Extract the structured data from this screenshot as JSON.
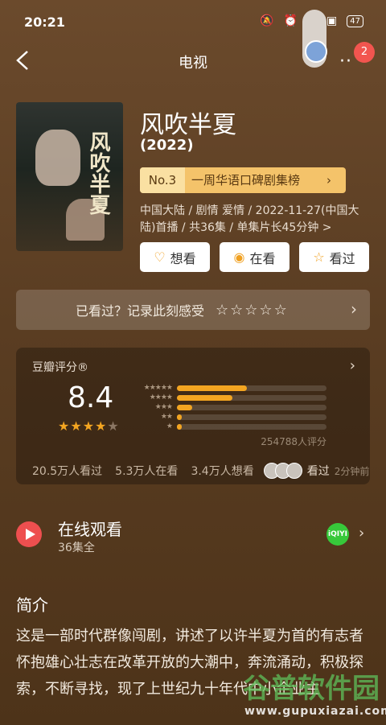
{
  "status": {
    "time": "20:21",
    "battery": "47"
  },
  "nav": {
    "title": "电视",
    "badge": "2",
    "more": "··"
  },
  "poster": {
    "title": "风吹半夏"
  },
  "show": {
    "title": "风吹半夏",
    "year": "(2022)",
    "rank_no": "No.3",
    "rank_name": "一周华语口碑剧集榜",
    "meta": "中国大陆 / 剧情 爱情 / 2022-11-27(中国大陆)首播 / 共36集 / 单集片长45分钟 >"
  },
  "actions": {
    "want": "想看",
    "watching": "在看",
    "watched": "看过"
  },
  "record": {
    "text": "已看过？记录此刻感受",
    "stars": "☆☆☆☆☆"
  },
  "rating": {
    "label": "豆瓣评分®",
    "score": "8.4",
    "stars_full": "★★★★",
    "stars_empty": "★",
    "distribution": [
      {
        "label": "★★★★★",
        "fraction": 0.47
      },
      {
        "label": "★★★★",
        "fraction": 0.37
      },
      {
        "label": "★★★",
        "fraction": 0.1
      },
      {
        "label": "★★",
        "fraction": 0.03
      },
      {
        "label": "★",
        "fraction": 0.03
      }
    ],
    "count": "254788人评分",
    "watched": "20.5万人看过",
    "watching": "5.3万人在看",
    "want": "3.4万人想看",
    "seen": "看过",
    "ago": "2分钟前"
  },
  "online": {
    "title": "在线观看",
    "subtitle": "36集全",
    "platform": "iQIYI"
  },
  "intro": {
    "title": "简介",
    "text": "这是一部时代群像闯剧，讲述了以许半夏为首的有志者怀抱雄心壮志在改革开放的大潮中，奔流涌动，积极探索，不断寻找，现了上世纪九十年代中小企业主"
  },
  "watermark": {
    "text": "谷普软件园",
    "url": "www.gupuxiazai.com"
  },
  "colors": {
    "accent": "#f3a521",
    "play": "#ee4f4f",
    "iqiyi": "#37c83a"
  }
}
